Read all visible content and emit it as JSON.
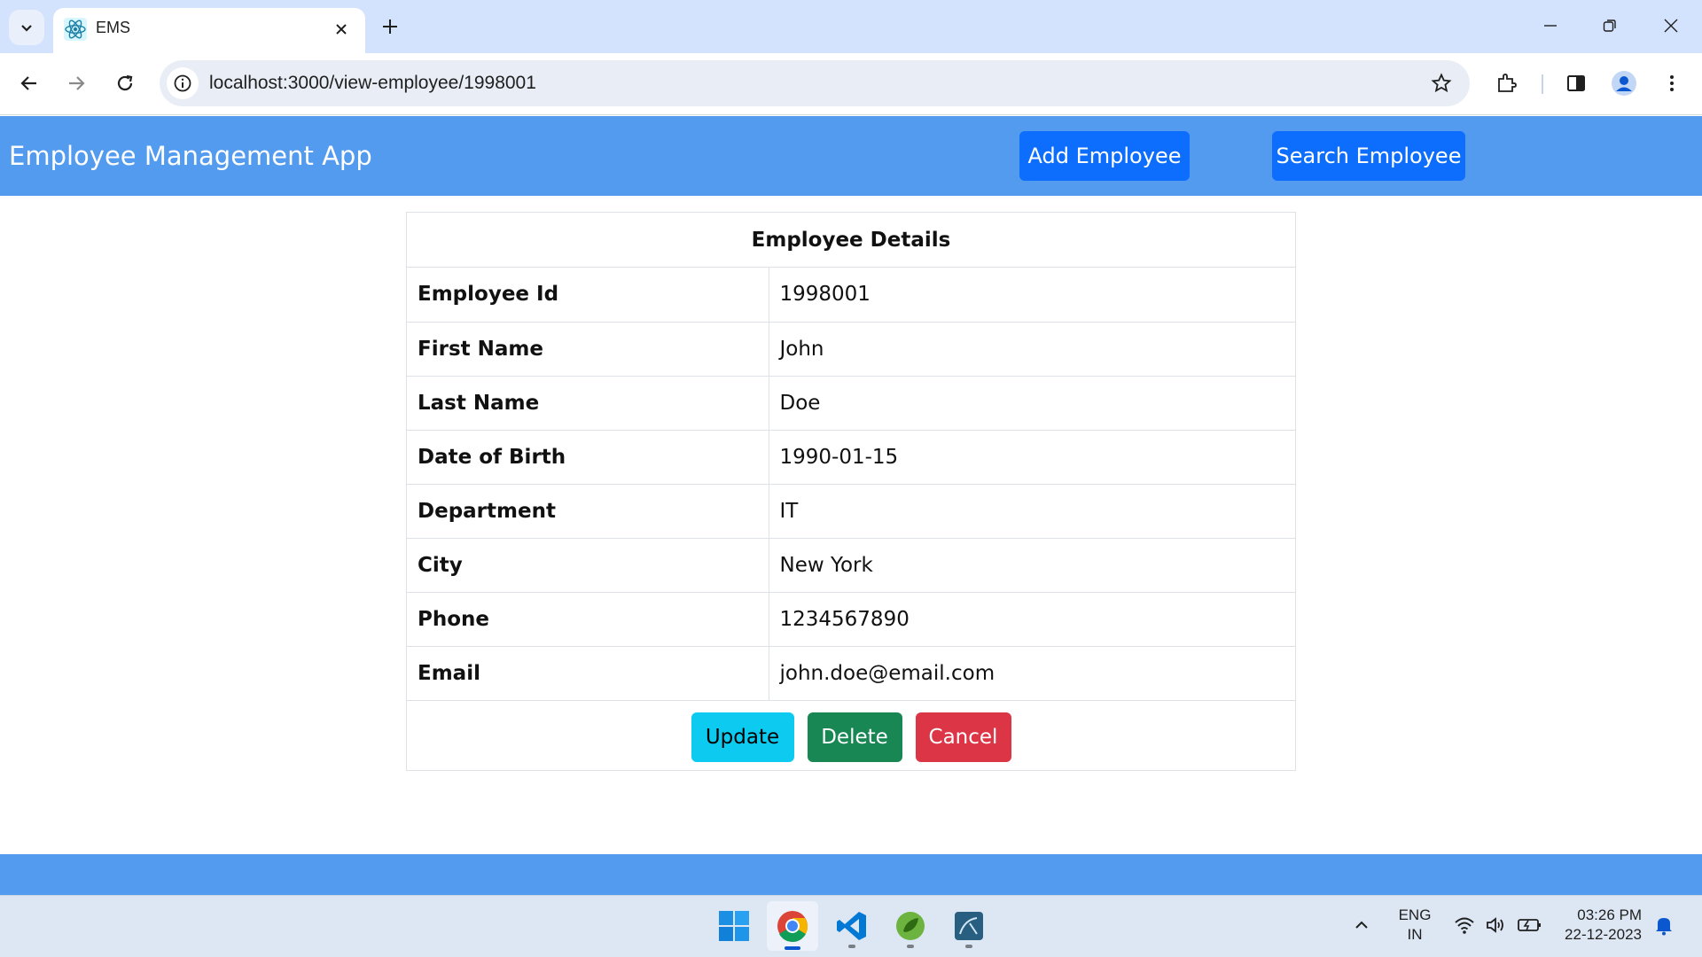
{
  "browser": {
    "tab_title": "EMS",
    "url": "localhost:3000/view-employee/1998001",
    "accent_color": "#d3e3fd"
  },
  "app": {
    "brand": "Employee Management App",
    "nav_color": "#539bee",
    "actions": {
      "add": "Add Employee",
      "search": "Search Employee"
    }
  },
  "details": {
    "title": "Employee Details",
    "rows": [
      {
        "label": "Employee Id",
        "value": "1998001"
      },
      {
        "label": "First Name",
        "value": "John"
      },
      {
        "label": "Last Name",
        "value": "Doe"
      },
      {
        "label": "Date of Birth",
        "value": "1990-01-15"
      },
      {
        "label": "Department",
        "value": "IT"
      },
      {
        "label": "City",
        "value": "New York"
      },
      {
        "label": "Phone",
        "value": "1234567890"
      },
      {
        "label": "Email",
        "value": "john.doe@email.com"
      }
    ],
    "buttons": {
      "update": "Update",
      "delete": "Delete",
      "cancel": "Cancel"
    },
    "button_colors": {
      "update": "#0dcaf0",
      "delete": "#198754",
      "cancel": "#dc3545"
    }
  },
  "taskbar": {
    "apps": [
      "windows-start-icon",
      "chrome-icon",
      "vscode-icon",
      "spring-tools-icon",
      "mysql-workbench-icon"
    ],
    "language_line1": "ENG",
    "language_line2": "IN",
    "time": "03:26 PM",
    "date": "22-12-2023"
  }
}
